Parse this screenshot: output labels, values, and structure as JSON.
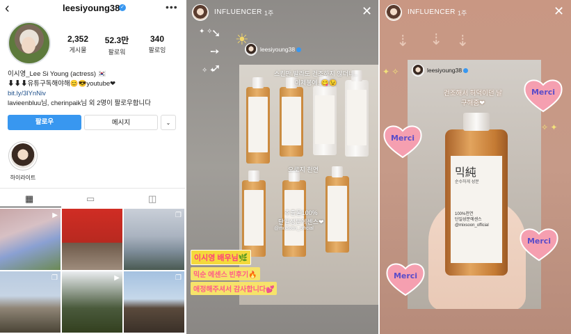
{
  "profile": {
    "username": "leesiyoung38",
    "stats": [
      {
        "value": "2,352",
        "label": "게시물"
      },
      {
        "value": "52.3만",
        "label": "팔로워"
      },
      {
        "value": "340",
        "label": "팔로잉"
      }
    ],
    "bio_name": "이시영_Lee Si Young (actress) 🇰🇷",
    "bio_line2": "⬇⬇⬇유튜구독해야해😊😎youtube❤",
    "bio_link": "bit.ly/3lYnNiv",
    "followed_by": "lavieenbluu님, cherinpaik님 외 2명이 팔로우합니다",
    "buttons": {
      "follow": "팔로우",
      "message": "메시지",
      "more": "⌄"
    },
    "highlight_label": "하이라이트"
  },
  "story1": {
    "title": "INFLUENCER",
    "time": "1주",
    "inner_username": "leesiyoung38",
    "caption_top": "스킨만 발라도 건조하지 않더니..\n이제봉에..😋😉",
    "caption_mid": "오로지 천연",
    "caption_low": "추출물100%\n단일성분에센스❤",
    "caption_handle": "@mixsoon_official",
    "sticker1": "이시영 배우님🌿",
    "sticker2": "믹순 에센스 빈후기🔥",
    "sticker3": "애정해주셔서 감사합니다💕"
  },
  "story2": {
    "title": "INFLUENCER",
    "time": "1주",
    "inner_username": "leesiyoung38",
    "caption": "건조해서 허덕이던 날\n구해줌❤",
    "bottle_title": "믹純",
    "bottle_sub": "순수하게 성분",
    "bottle_text": "100%천연\n단일성분에센스\n@mixsoon_official",
    "merci": "Merci"
  }
}
